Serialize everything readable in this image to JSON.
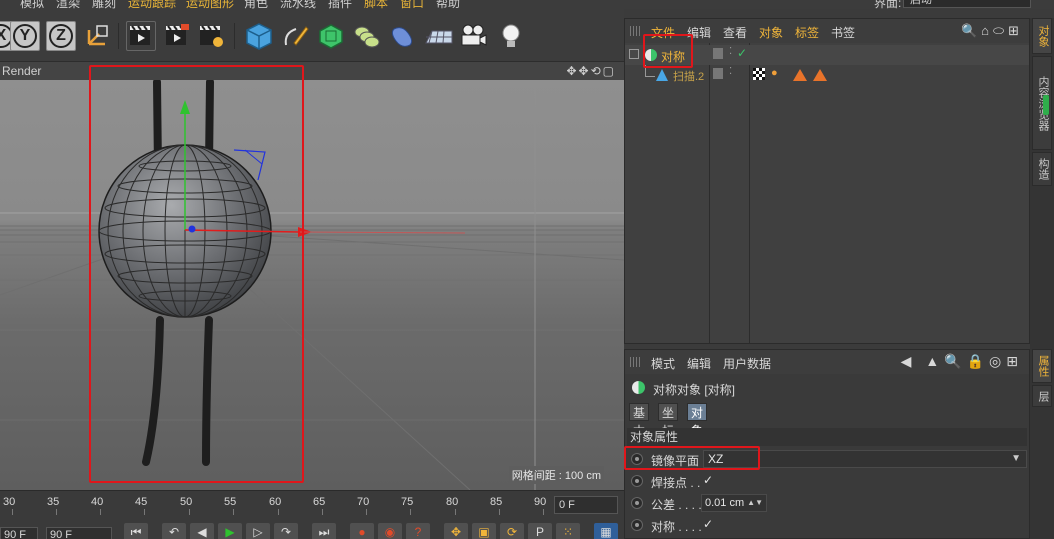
{
  "menubar": {
    "items": [
      "模拟",
      "渲染",
      "雕刻",
      "运动跟踪",
      "运动图形",
      "角色",
      "流水线",
      "插件",
      "脚本",
      "窗口",
      "帮助"
    ],
    "highlighted": [
      "运动跟踪",
      "运动图形",
      "脚本",
      "窗口"
    ],
    "layout_label": "界面:",
    "layout_value": "启动"
  },
  "toolbar": {
    "axis_buttons": [
      "X",
      "Y",
      "Z"
    ]
  },
  "viewport": {
    "title": "Render",
    "grid_spacing": "网格间距 : 100 cm"
  },
  "timeline": {
    "ruler": [
      "30",
      "35",
      "40",
      "45",
      "50",
      "55",
      "60",
      "65",
      "70",
      "75",
      "80",
      "85",
      "90"
    ],
    "current_frame": "0 F",
    "start_field": "90 F",
    "end_field": "90 F"
  },
  "object_manager": {
    "menu": [
      "文件",
      "编辑",
      "查看",
      "对象",
      "标签",
      "书签"
    ],
    "objects": [
      {
        "name": "对称",
        "check": "✓"
      },
      {
        "name": "扫描.2"
      }
    ]
  },
  "attribute_manager": {
    "menu": [
      "模式",
      "编辑",
      "用户数据"
    ],
    "object_title": "对称对象 [对称]",
    "tabs": [
      "基本",
      "坐标",
      "对象"
    ],
    "active_tab": "对象",
    "section": "对象属性",
    "rows": [
      {
        "label": "镜像平面",
        "value": "XZ"
      },
      {
        "label": "焊接点 . .",
        "value": "✓"
      },
      {
        "label": "公差 . . . .",
        "value": "0.01 cm"
      },
      {
        "label": "对称 . . . .",
        "value": "✓"
      }
    ]
  },
  "side_tabs": [
    "对象",
    "内容浏览器",
    "构造",
    "属性",
    "层"
  ],
  "colors": {
    "accent_orange": "#f0b53a",
    "highlight_red": "#e0161b",
    "active_tab": "#6b7f95",
    "axis_green": "#2fc32f",
    "axis_red": "#e21c1c"
  }
}
